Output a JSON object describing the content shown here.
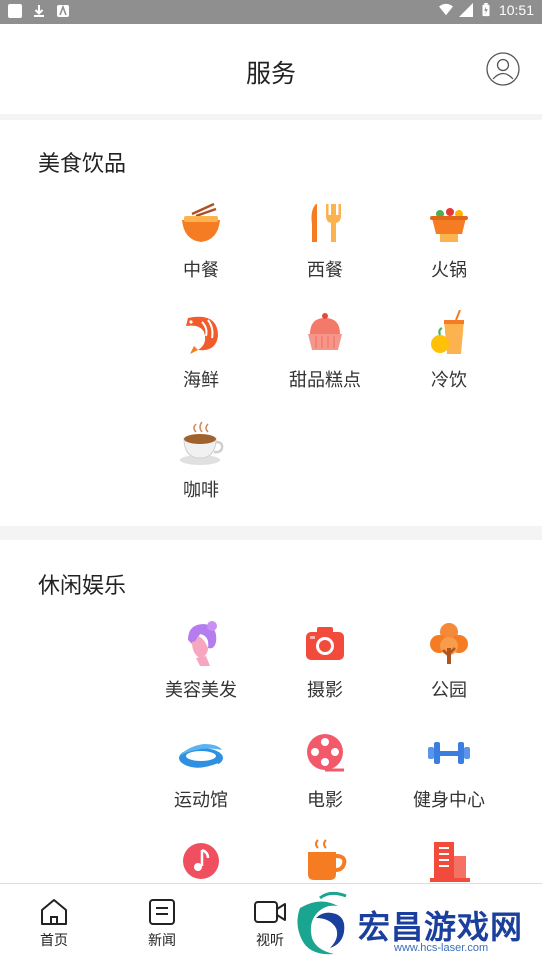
{
  "status_bar": {
    "time": "10:51"
  },
  "header": {
    "title": "服务"
  },
  "sections": {
    "food": {
      "title": "美食饮品",
      "items": [
        {
          "label": "中餐",
          "icon": "noodle-bowl-icon"
        },
        {
          "label": "西餐",
          "icon": "fork-knife-icon"
        },
        {
          "label": "火锅",
          "icon": "hotpot-icon"
        },
        {
          "label": "海鲜",
          "icon": "shrimp-icon"
        },
        {
          "label": "甜品糕点",
          "icon": "cake-icon"
        },
        {
          "label": "冷饮",
          "icon": "juice-icon"
        },
        {
          "label": "咖啡",
          "icon": "coffee-cup-icon"
        }
      ]
    },
    "leisure": {
      "title": "休闲娱乐",
      "items": [
        {
          "label": "美容美发",
          "icon": "beauty-head-icon"
        },
        {
          "label": "摄影",
          "icon": "camera-icon"
        },
        {
          "label": "公园",
          "icon": "tree-icon"
        },
        {
          "label": "运动馆",
          "icon": "stadium-icon"
        },
        {
          "label": "电影",
          "icon": "film-reel-icon"
        },
        {
          "label": "健身中心",
          "icon": "dumbbell-icon"
        },
        {
          "label": "",
          "icon": "music-note-icon"
        },
        {
          "label": "",
          "icon": "tea-mug-icon"
        },
        {
          "label": "",
          "icon": "building-icon"
        }
      ]
    }
  },
  "tabbar": {
    "tabs": [
      {
        "label": "首页",
        "icon": "home-icon"
      },
      {
        "label": "新闻",
        "icon": "news-icon"
      },
      {
        "label": "视听",
        "icon": "video-camera-icon"
      }
    ]
  },
  "watermark": {
    "text": "宏昌游戏网",
    "url": "www.hcs-laser.com"
  },
  "colors": {
    "orange": "#f57c22",
    "red": "#f24b3c",
    "pink": "#f26b8a",
    "blue": "#3c7de0",
    "purple": "#b57cf0"
  }
}
